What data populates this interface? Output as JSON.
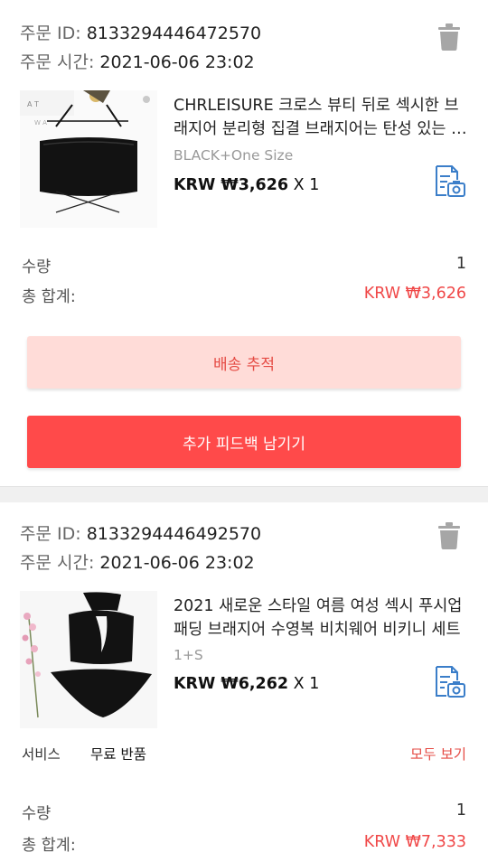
{
  "colors": {
    "accent": "#ff4a4a",
    "accent_light": "#ffdcd8",
    "price_total": "#f04848",
    "icon_blue": "#3b7ec9"
  },
  "labels": {
    "order_id": "주문 ID: ",
    "order_time": "주문 시간: ",
    "quantity": "수량",
    "total": "총 합계:",
    "service": "서비스",
    "view_all": "모두 보기"
  },
  "orders": [
    {
      "order_id": "8133294446472570",
      "order_time": "2021-06-06 23:02",
      "product_title": "CHRLEISURE 크로스 뷰티 뒤로 섹시한 브래지어 분리형 집결 브래지어는 탄성 있는 스포츠 브래지어",
      "variant": "BLACK+One Size",
      "price": "KRW ₩3,626",
      "qty_suffix": " X 1",
      "quantity": "1",
      "total": "KRW ₩3,626",
      "buttons": {
        "track": "배송 추적",
        "feedback": "추가 피드백 남기기"
      },
      "icons": {
        "delete": "trash-icon",
        "photo_review": "photo-review-icon"
      }
    },
    {
      "order_id": "8133294446492570",
      "order_time": "2021-06-06 23:02",
      "product_title": "2021 새로운 스타일 여름 여성 섹시 푸시업 패딩 브래지어 수영복 비치웨어 비키니 세트",
      "variant": "1+S",
      "price": "KRW ₩6,262",
      "qty_suffix": " X 1",
      "service_value": "무료 반품",
      "quantity": "1",
      "total": "KRW ₩7,333",
      "icons": {
        "delete": "trash-icon",
        "photo_review": "photo-review-icon"
      }
    }
  ]
}
